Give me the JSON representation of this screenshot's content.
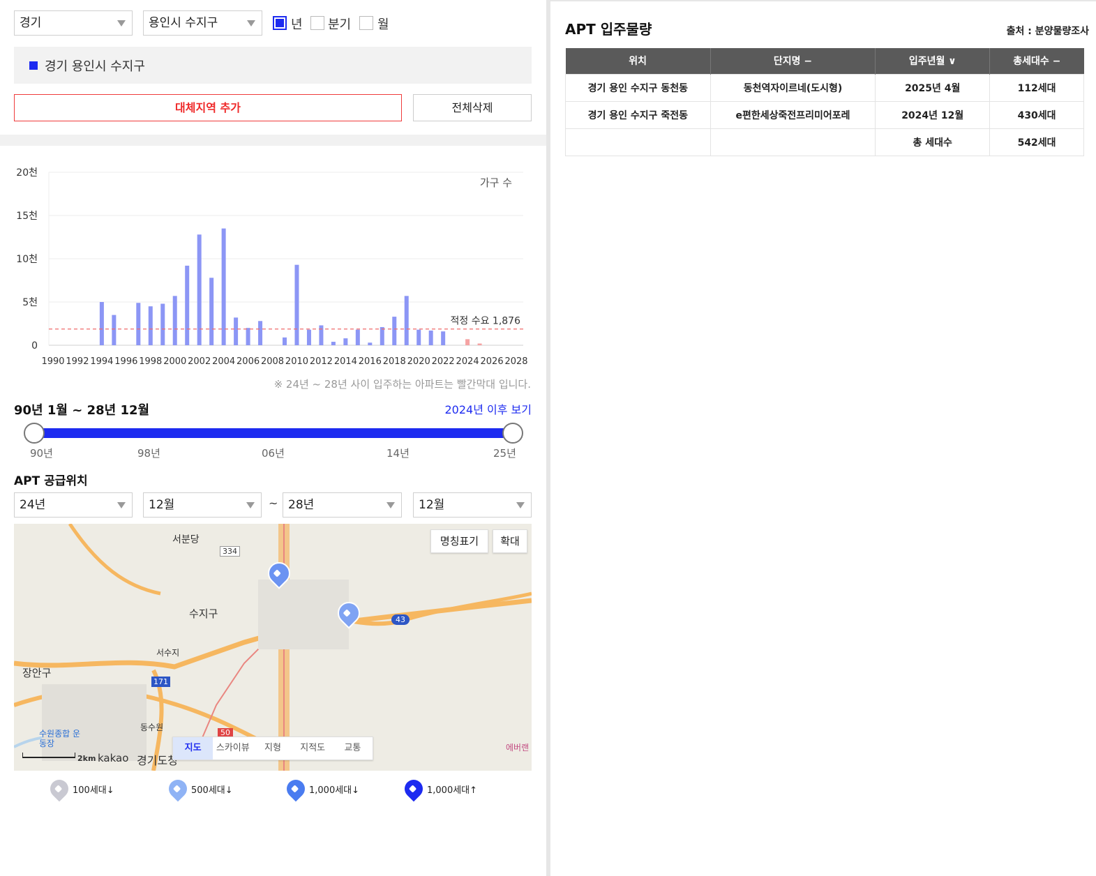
{
  "filters": {
    "province": "경기",
    "district": "용인시 수지구",
    "period_options": [
      {
        "label": "년",
        "checked": true
      },
      {
        "label": "분기",
        "checked": false
      },
      {
        "label": "월",
        "checked": false
      }
    ]
  },
  "selected_region": "경기 용인시 수지구",
  "buttons": {
    "add_alt_region": "대체지역 추가",
    "delete_all": "전체삭제"
  },
  "chart_data": {
    "type": "bar",
    "series_label": "가구 수",
    "x": [
      1990,
      1991,
      1992,
      1993,
      1994,
      1995,
      1996,
      1997,
      1998,
      1999,
      2000,
      2001,
      2002,
      2003,
      2004,
      2005,
      2006,
      2007,
      2008,
      2009,
      2010,
      2011,
      2012,
      2013,
      2014,
      2015,
      2016,
      2017,
      2018,
      2019,
      2020,
      2021,
      2022,
      2023,
      2024,
      2025,
      2026,
      2027,
      2028
    ],
    "values": [
      0,
      0,
      0,
      0,
      5000,
      3500,
      0,
      4900,
      4500,
      4800,
      5700,
      9200,
      12800,
      7800,
      13500,
      3200,
      2000,
      2800,
      0,
      900,
      9300,
      1800,
      2300,
      400,
      800,
      1800,
      300,
      2100,
      3300,
      5700,
      1800,
      1700,
      1600,
      0,
      700,
      200,
      0,
      0,
      0
    ],
    "highlight_years": [
      2024,
      2025,
      2026,
      2027,
      2028
    ],
    "xtick_labels": [
      "1990",
      "1992",
      "1994",
      "1996",
      "1998",
      "2000",
      "2002",
      "2004",
      "2006",
      "2008",
      "2010",
      "2012",
      "2014",
      "2016",
      "2018",
      "2020",
      "2022",
      "2024",
      "2026",
      "2028"
    ],
    "ytick_labels": [
      "0",
      "5천",
      "10천",
      "15천",
      "20천"
    ],
    "ylim": [
      0,
      20000
    ],
    "reference_line": {
      "value": 1876,
      "label": "적정 수요 1,876"
    },
    "note": "※ 24년 ~ 28년 사이 입주하는 아파트는 빨간막대 입니다.",
    "colors": {
      "normal": "#8c96f5",
      "highlight": "#f5a3a3",
      "reference": "#ef6b6b"
    }
  },
  "range": {
    "title": "90년 1월 ~ 28년 12월",
    "after_link": "2024년 이후 보기",
    "ticks": [
      "90년",
      "98년",
      "06년",
      "14년",
      "25년"
    ]
  },
  "supply": {
    "title": "APT 공급위치",
    "from_year": "24년",
    "from_month": "12월",
    "separator": "~",
    "to_year": "28년",
    "to_month": "12월"
  },
  "map": {
    "btn_names": "명칭표기",
    "btn_zoom": "확대",
    "labels": [
      "서분당",
      "수지구",
      "서수지",
      "장안구",
      "동수원",
      "수원종합 운동장",
      "경기도청",
      "에버랜"
    ],
    "scale": "2km",
    "brand": "kakao",
    "road_numbers": [
      "334",
      "43",
      "171",
      "50"
    ],
    "types": [
      "지도",
      "스카이뷰",
      "지형",
      "지적도",
      "교통"
    ],
    "active_type": "지도"
  },
  "legend": [
    {
      "label": "100세대↓",
      "color": "#c9c9d2"
    },
    {
      "label": "500세대↓",
      "color": "#8fb3f5"
    },
    {
      "label": "1,000세대↓",
      "color": "#4a7cf0"
    },
    {
      "label": "1,000세대↑",
      "color": "#1d2bf0"
    }
  ],
  "right": {
    "title": "APT 입주물량",
    "source": "출처 : 분양물량조사",
    "headers": [
      "위치",
      "단지명 −",
      "입주년월 ∨",
      "총세대수 −"
    ],
    "rows": [
      [
        "경기 용인 수지구 동천동",
        "동천역자이르네(도시형)",
        "2025년 4월",
        "112세대"
      ],
      [
        "경기 용인 수지구 죽전동",
        "e편한세상죽전프리미어포레",
        "2024년 12월",
        "430세대"
      ],
      [
        "",
        "",
        "총 세대수",
        "542세대"
      ]
    ]
  }
}
